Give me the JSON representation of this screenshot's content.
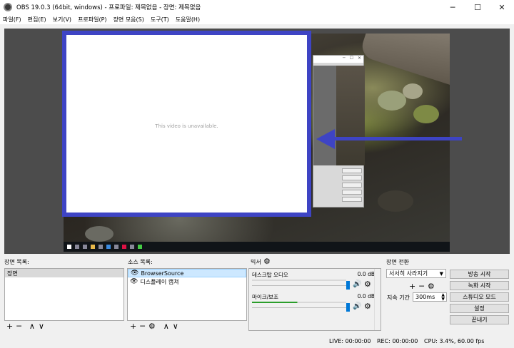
{
  "window": {
    "title": "OBS 19.0.3 (64bit, windows) - 프로파일: 제목없음 - 장면: 제목없음",
    "minimize": "─",
    "maximize": "☐",
    "close": "✕"
  },
  "menu": [
    "파일(F)",
    "편집(E)",
    "보기(V)",
    "프로파일(P)",
    "장면 모음(S)",
    "도구(T)",
    "도움말(H)"
  ],
  "preview": {
    "browser_message": "This video is unavailable.",
    "accent_color": "#3e44c4"
  },
  "scenes": {
    "label": "장면 목록:",
    "items": [
      "장면"
    ],
    "add": "+",
    "remove": "─",
    "up": "∧",
    "down": "∨"
  },
  "sources": {
    "label": "소스 목록:",
    "items": [
      {
        "name": "BrowserSource",
        "icon": "eye-icon"
      },
      {
        "name": "디스플레이 캡쳐",
        "icon": "eye-icon"
      }
    ],
    "add": "+",
    "remove": "─",
    "settings": "⚙",
    "up": "∧",
    "down": "∨"
  },
  "mixer": {
    "label": "믹서",
    "channels": [
      {
        "name": "데스크탑 오디오",
        "db": "0.0 dB"
      },
      {
        "name": "마이크/보조",
        "db": "0.0 dB"
      }
    ]
  },
  "transitions": {
    "label": "장면 전환",
    "selected": "서서히 사라지기",
    "add": "+",
    "remove": "─",
    "duration_label": "지속 기간",
    "duration_value": "300ms"
  },
  "controls": {
    "start_streaming": "방송 시작",
    "start_recording": "녹화 시작",
    "studio_mode": "스튜디오 모드",
    "settings": "설정",
    "exit": "끝내기"
  },
  "status": {
    "live": "LIVE: 00:00:00",
    "rec": "REC: 00:00:00",
    "cpu": "CPU: 3.4%, 60.00 fps"
  }
}
